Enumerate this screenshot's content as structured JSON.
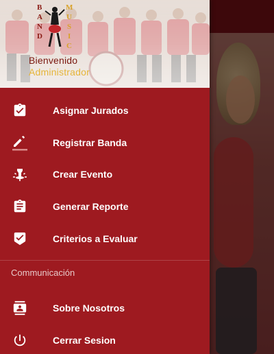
{
  "header": {
    "welcome": "Bienvenido",
    "role": "Administrador",
    "logo_words": [
      "BAND",
      "MUSIC"
    ]
  },
  "menu": {
    "items": [
      {
        "label": "Asignar Jurados",
        "icon": "assignment-check-icon"
      },
      {
        "label": "Registrar Banda",
        "icon": "edit-pencil-icon"
      },
      {
        "label": "Crear Evento",
        "icon": "event-lamp-icon"
      },
      {
        "label": "Generar Reporte",
        "icon": "clipboard-report-icon"
      },
      {
        "label": "Criterios a Evaluar",
        "icon": "verified-check-icon"
      }
    ]
  },
  "communication": {
    "title": "Communicación",
    "items": [
      {
        "label": "Sobre Nosotros",
        "icon": "contact-card-icon"
      },
      {
        "label": "Cerrar Sesion",
        "icon": "power-icon"
      }
    ]
  },
  "colors": {
    "drawer": "#9e1a20",
    "toolbar": "#5e0d12",
    "welcome_text": "#7a1810",
    "role_text": "#e6b63a"
  }
}
